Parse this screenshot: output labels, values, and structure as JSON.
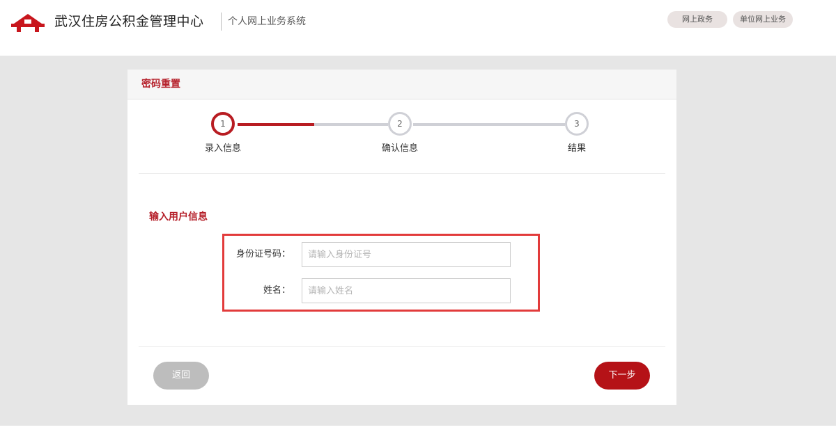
{
  "header": {
    "brand": "武汉住房公积金管理中心",
    "subtitle": "个人网上业务系统",
    "links": [
      "网上政务",
      "单位网上业务"
    ]
  },
  "card": {
    "title": "密码重置",
    "steps": [
      {
        "number": "1",
        "label": "录入信息",
        "state": "active"
      },
      {
        "number": "2",
        "label": "确认信息",
        "state": "pending"
      },
      {
        "number": "3",
        "label": "结果",
        "state": "pending"
      }
    ],
    "section_title": "输入用户信息",
    "form": {
      "id_label": "身份证号码：",
      "id_placeholder": "请输入身份证号",
      "id_value": "",
      "name_label": "姓名：",
      "name_placeholder": "请输入姓名",
      "name_value": ""
    },
    "buttons": {
      "back": "返回",
      "next": "下一步"
    }
  },
  "colors": {
    "accent": "#b81c22",
    "highlight_border": "#e23b3b",
    "background_gray": "#e6e6e6"
  }
}
